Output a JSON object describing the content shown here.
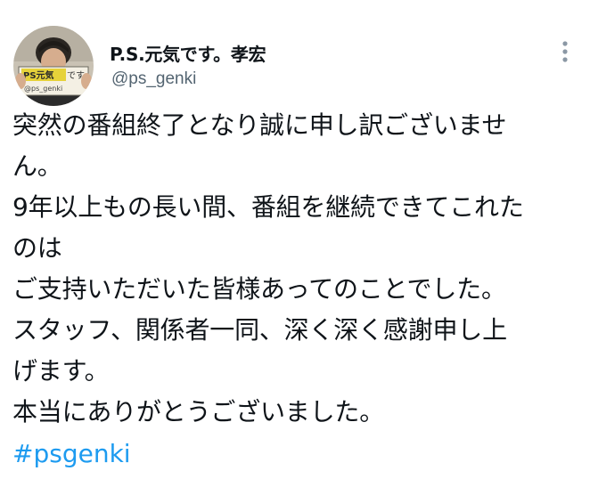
{
  "tweet": {
    "author": {
      "display_name": "P.S.元気です。孝宏",
      "handle": "@ps_genki",
      "avatar": {
        "icon": "profile-photo-avatar",
        "sign_text": "@ps_genki"
      }
    },
    "menu_icon": "more-options-icon",
    "body_lines": [
      "突然の番組終了となり誠に申し訳ございませ",
      "ん。",
      "9年以上もの長い間、番組を継続できてこれた",
      "のは",
      "ご支持いただいた皆様あってのことでした。",
      "スタッフ、関係者一同、深く深く感謝申し上",
      "げます。",
      "本当にありがとうございました。"
    ],
    "hashtag": "#psgenki"
  },
  "colors": {
    "text": "#0f1419",
    "secondary_text": "#536471",
    "link": "#1d9bf0",
    "background": "#ffffff"
  }
}
